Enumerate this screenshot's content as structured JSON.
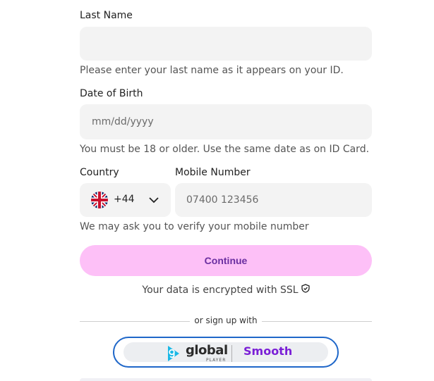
{
  "last_name": {
    "label": "Last Name",
    "value": "",
    "hint": "Please enter your last name as it appears on your ID."
  },
  "dob": {
    "label": "Date of Birth",
    "placeholder": "mm/dd/yyyy",
    "hint": "You must be 18 or older. Use the same date as on ID Card."
  },
  "country": {
    "label": "Country",
    "code": "+44",
    "flag": "uk-flag-icon"
  },
  "mobile": {
    "label": "Mobile Number",
    "placeholder": "07400 123456",
    "hint": "We may ask you to verify your mobile number"
  },
  "continue_label": "Continue",
  "ssl_text": "Your data is encrypted with SSL",
  "or_text": "or sign up with",
  "brands": {
    "global_word": "global",
    "global_sub": "PLAYER",
    "smooth_word": "Smooth"
  },
  "colors": {
    "continue_bg": "#fdc0f7",
    "continue_text": "#6a2ea0",
    "brand_border": "#1f67c9",
    "smooth": "#7a1fd6",
    "global_icon": "#1ab8e6"
  }
}
